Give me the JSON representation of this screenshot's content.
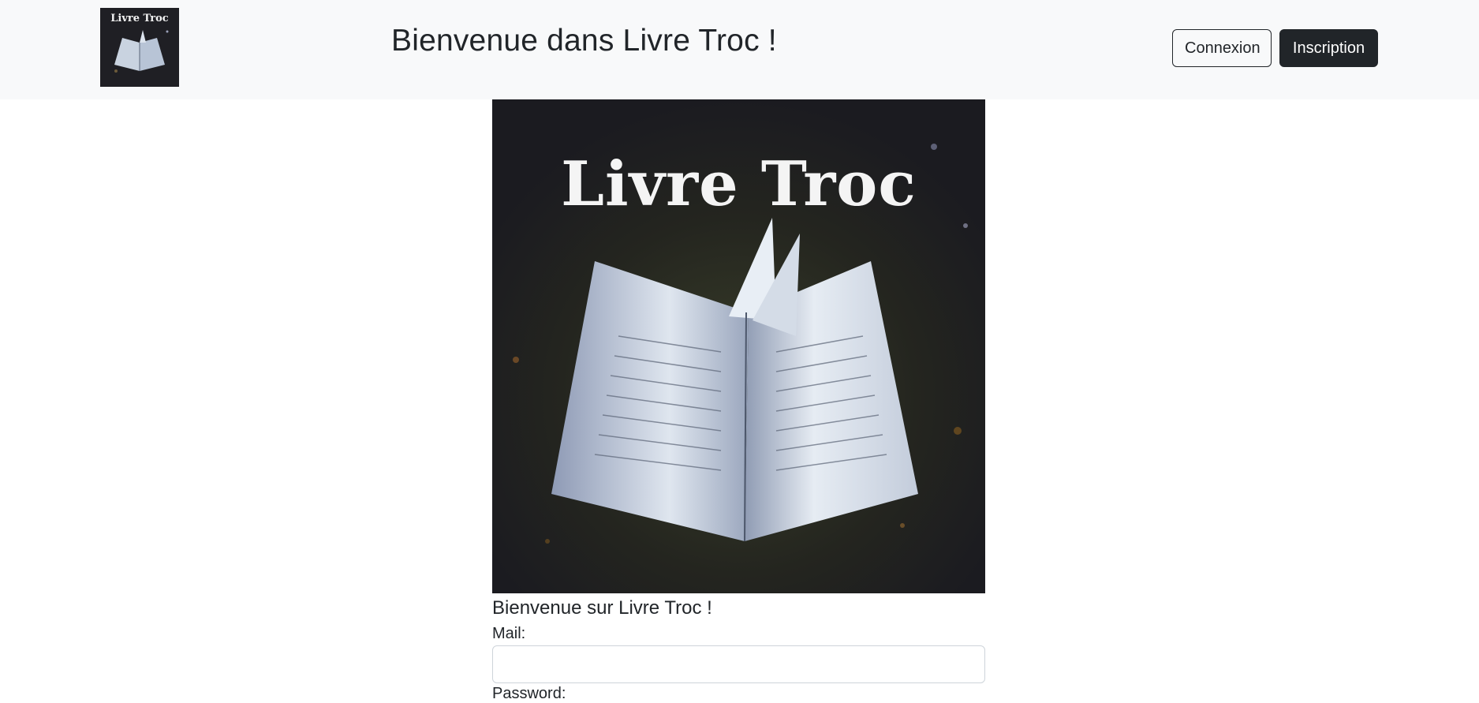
{
  "header": {
    "logo_text": "Livre Troc",
    "title": "Bienvenue dans Livre Troc !",
    "login_label": "Connexion",
    "signup_label": "Inscription"
  },
  "hero": {
    "title": "Livre Troc"
  },
  "form": {
    "heading": "Bienvenue sur Livre Troc !",
    "mail_label": "Mail:",
    "mail_value": "",
    "password_label": "Password:"
  },
  "colors": {
    "navbar_bg": "#f8f9fa",
    "dark_button": "#212529",
    "hero_bg": "#1e1e23"
  }
}
